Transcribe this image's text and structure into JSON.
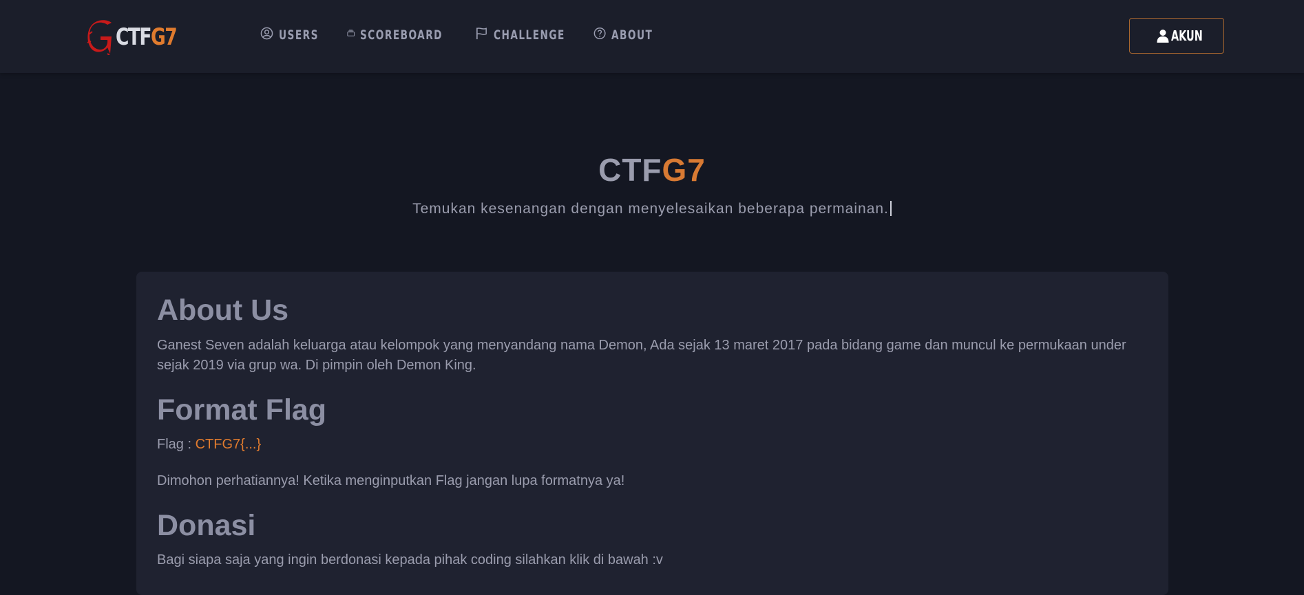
{
  "brand": {
    "text_a": "CTF",
    "text_b": "G7"
  },
  "nav": {
    "items": [
      {
        "label": "USERS",
        "icon": "user-circle-icon"
      },
      {
        "label": "SCOREBOARD",
        "icon": "scoreboard-icon"
      },
      {
        "label": "CHALLENGE",
        "icon": "flag-icon"
      },
      {
        "label": "ABOUT",
        "icon": "question-circle-icon"
      }
    ],
    "account_button": {
      "label": "AKUN",
      "icon": "user-icon"
    }
  },
  "hero": {
    "title_a": "CTF",
    "title_b": "G7",
    "subtitle": "Temukan kesenangan dengan menyelesaikan beberapa permainan."
  },
  "about": {
    "heading": "About Us",
    "text": "Ganest Seven adalah keluarga atau kelompok yang menyandang nama Demon, Ada sejak 13 maret 2017 pada bidang game dan muncul ke permukaan under sejak 2019 via grup wa. Di pimpin oleh Demon King."
  },
  "format_flag": {
    "heading": "Format Flag",
    "label": "Flag : ",
    "value": "CTFG7{...}",
    "note": "Dimohon perhatiannya! Ketika menginputkan Flag jangan lupa formatnya ya!"
  },
  "donasi": {
    "heading": "Donasi",
    "text": "Bagi siapa saja yang ingin berdonasi kepada pihak coding silahkan klik di bawah :v"
  },
  "colors": {
    "background": "#141722",
    "navbar": "#1b1e2a",
    "card": "#1f2230",
    "accent": "#e07b2e",
    "text_muted": "#9a9cad",
    "logo_red": "#d41e1e"
  }
}
